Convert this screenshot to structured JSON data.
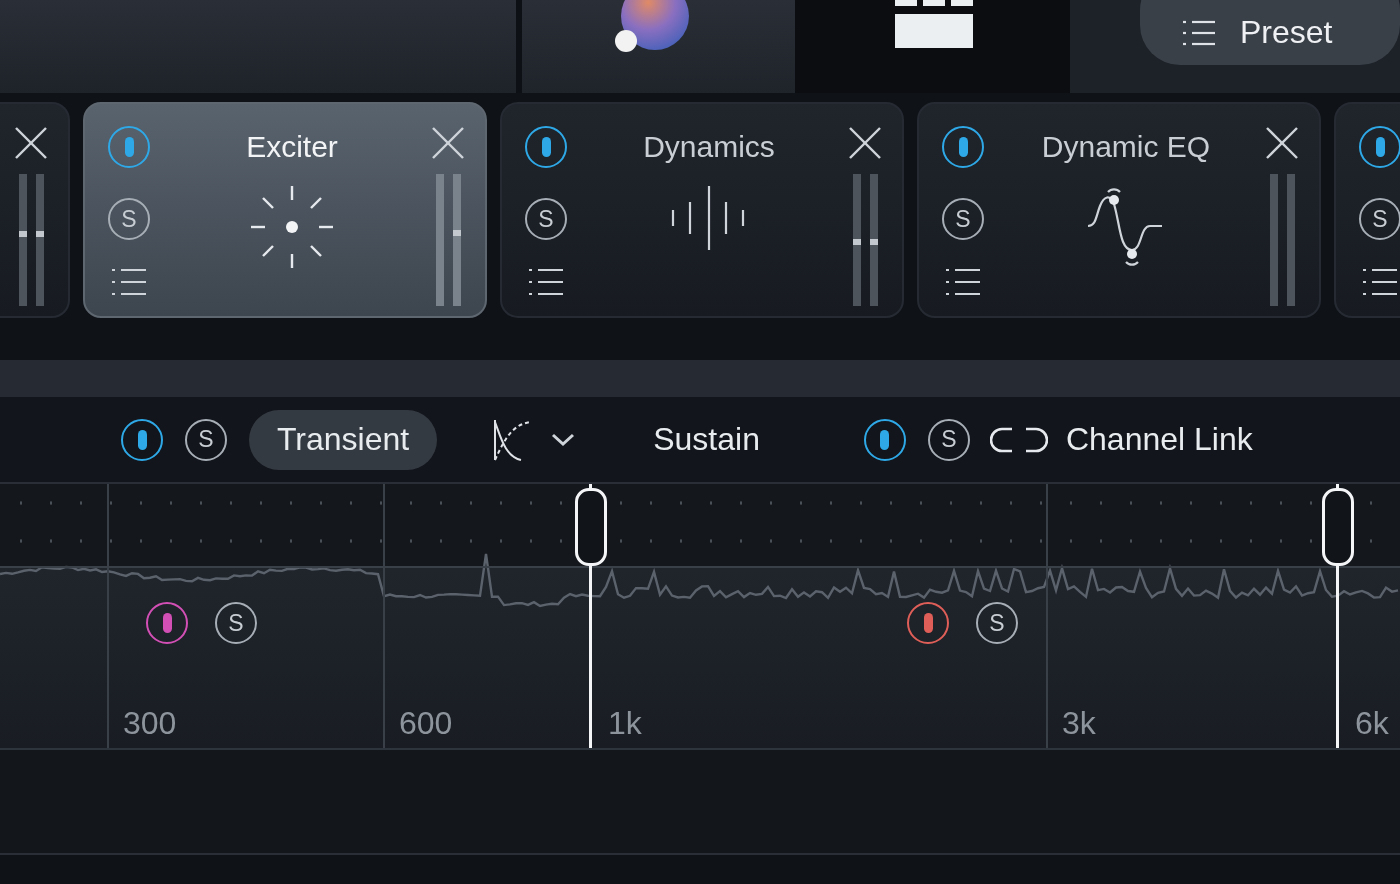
{
  "top_bar": {
    "presets_label": "Preset"
  },
  "modules": [
    {
      "kind": "partial-left",
      "selected": false,
      "meters": [
        {
          "marker": true,
          "level": 0.52
        },
        {
          "marker": true,
          "level": 0.52
        }
      ]
    },
    {
      "kind": "exciter",
      "title": "Exciter",
      "selected": true,
      "power_on": true,
      "solo": "S",
      "meters": [
        {
          "marker": false
        },
        {
          "marker": true,
          "level": 0.53
        }
      ]
    },
    {
      "kind": "dynamics",
      "title": "Dynamics",
      "selected": false,
      "power_on": true,
      "solo": "S",
      "meters": [
        {
          "marker": true,
          "level": 0.46
        },
        {
          "marker": true,
          "level": 0.46
        }
      ]
    },
    {
      "kind": "dynamic-eq",
      "title": "Dynamic EQ",
      "selected": false,
      "power_on": true,
      "solo": "S",
      "meters": [
        {
          "marker": false
        },
        {
          "marker": false
        }
      ]
    },
    {
      "kind": "partial-right",
      "selected": false,
      "power_on": true,
      "solo": "S"
    }
  ],
  "controls": {
    "left_power_on": true,
    "left_solo": "S",
    "modes": [
      {
        "label": "Transient",
        "selected": true
      },
      {
        "label": "Sustain",
        "selected": false
      }
    ],
    "right_power_on": true,
    "right_solo": "S",
    "channel_link": "Channel Link"
  },
  "spectrum": {
    "frequency_labels": [
      "300",
      "600",
      "1k",
      "3k",
      "6k"
    ],
    "bands": [
      {
        "color": "#d24fb5",
        "on": true,
        "solo": "S"
      },
      {
        "color": "#df5f58",
        "on": true,
        "solo": "S"
      }
    ]
  }
}
